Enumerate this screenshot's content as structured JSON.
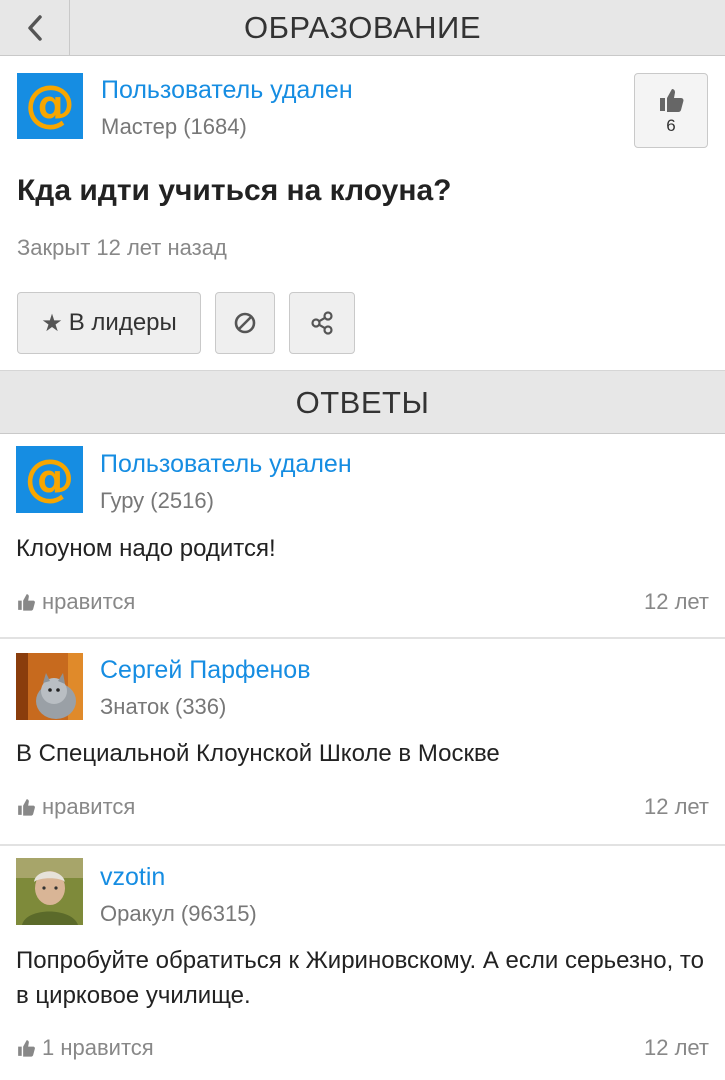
{
  "header": {
    "title": "ОБРАЗОВАНИЕ"
  },
  "question": {
    "author": {
      "name": "Пользователь удален",
      "rank": "Мастер (1684)",
      "avatar": "mail-at-icon"
    },
    "likes": "6",
    "title": "Кда идти учиться на клоуна?",
    "status": "Закрыт 12 лет назад",
    "actions": {
      "leader_label": "В лидеры",
      "leader_icon": "★"
    }
  },
  "answers_header": "ОТВЕТЫ",
  "answers": [
    {
      "author": {
        "name": "Пользователь удален",
        "rank": "Гуру (2516)",
        "avatar": "mail-at-icon"
      },
      "text": "Клоуном надо родится!",
      "like_label": "нравится",
      "time": "12 лет"
    },
    {
      "author": {
        "name": "Сергей Парфенов",
        "rank": "Знаток (336)",
        "avatar": "cat-photo"
      },
      "text": "В Специальной Клоунской Школе в Москве",
      "like_label": "нравится",
      "time": "12 лет"
    },
    {
      "author": {
        "name": "vzotin",
        "rank": "Оракул (96315)",
        "avatar": "person-photo"
      },
      "text": "Попробуйте обратиться к Жириновскому. А если серьезно, то в цирковое училище.",
      "like_label": "1 нравится",
      "time": "12 лет"
    }
  ],
  "colors": {
    "link": "#168de2",
    "mail_bg": "#168de2",
    "mail_at": "#f7a600",
    "header_bg": "#e7e7e7"
  }
}
